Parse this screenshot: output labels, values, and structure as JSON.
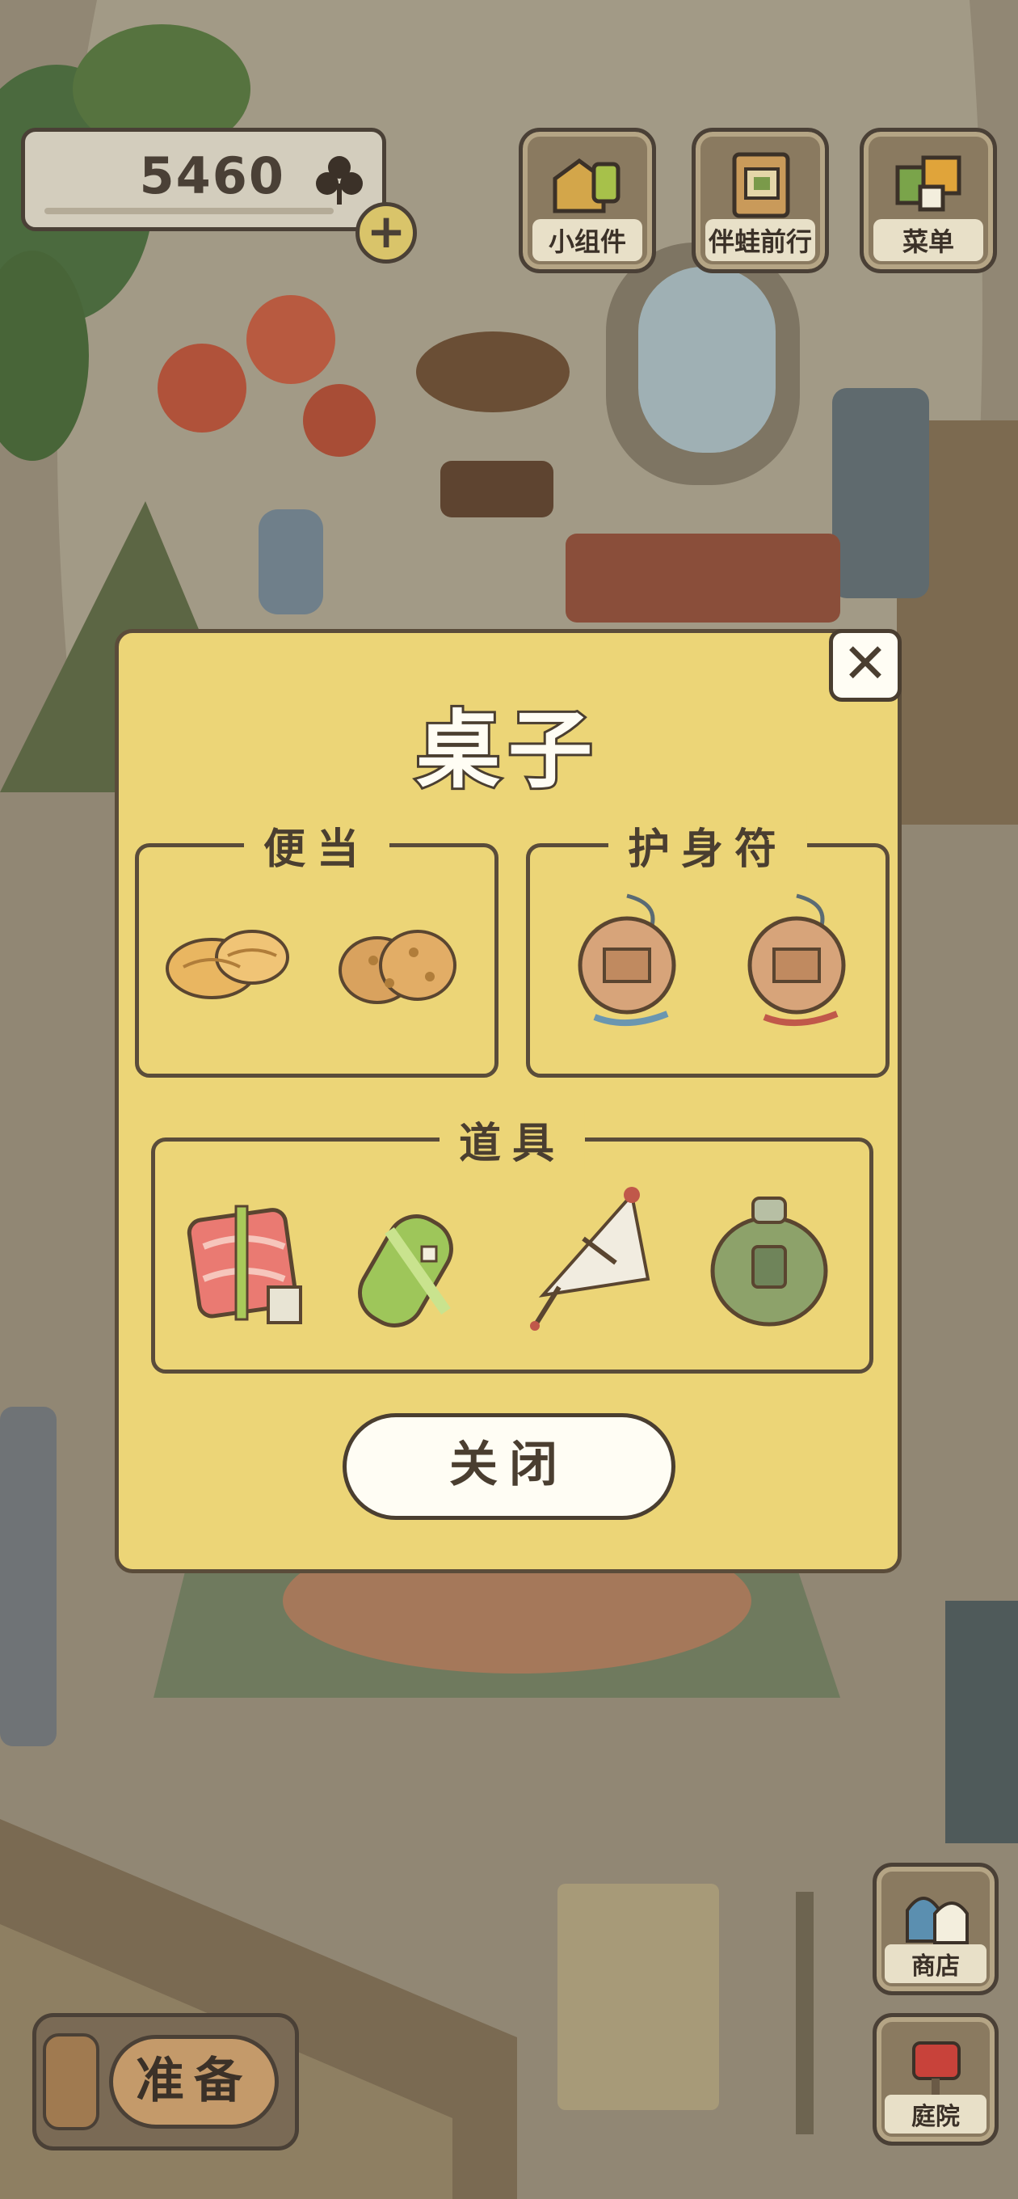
{
  "currency": {
    "count": "5460",
    "icon": "clover-icon"
  },
  "top_menu": [
    {
      "label": "小组件",
      "icon": "gadget-icon"
    },
    {
      "label": "伴蛙前行",
      "icon": "album-icon"
    },
    {
      "label": "菜单",
      "icon": "menu-icon"
    }
  ],
  "dialog": {
    "title": "桌子",
    "sections": [
      {
        "label": "便当",
        "items": [
          "rolled-bread-icon",
          "crumble-bread-icon"
        ]
      },
      {
        "label": "护身符",
        "items": [
          "wooden-charm-blue-icon",
          "wooden-charm-red-icon"
        ]
      },
      {
        "label": "道具",
        "items": [
          "pink-blanket-icon",
          "green-mat-icon",
          "paper-umbrella-icon",
          "canteen-icon"
        ]
      }
    ],
    "close_label": "关闭",
    "close_icon": "close-icon"
  },
  "bottom": {
    "ready_label": "准备",
    "shop_label": "商店",
    "yard_label": "庭院"
  },
  "colors": {
    "dialog_bg": "#ecd577",
    "outline": "#4a3e30",
    "scene_dim": "#8d8270"
  }
}
